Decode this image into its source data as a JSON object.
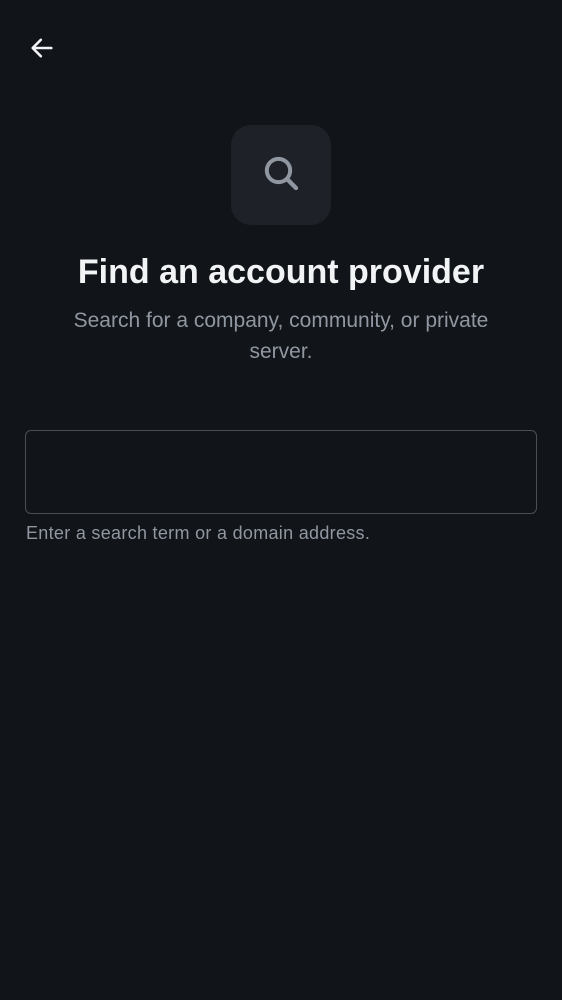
{
  "header": {
    "back_icon": "arrow-left-icon"
  },
  "hero": {
    "icon": "search-icon",
    "title": "Find an account provider",
    "subtitle": "Search for a company, community, or private server."
  },
  "search": {
    "value": "",
    "placeholder": "",
    "helper_text": "Enter a search term or a domain address."
  },
  "colors": {
    "background": "#111418",
    "tile": "#1e2127",
    "title": "#f2f3f5",
    "muted": "#9097a1",
    "border": "#4a4f57"
  }
}
